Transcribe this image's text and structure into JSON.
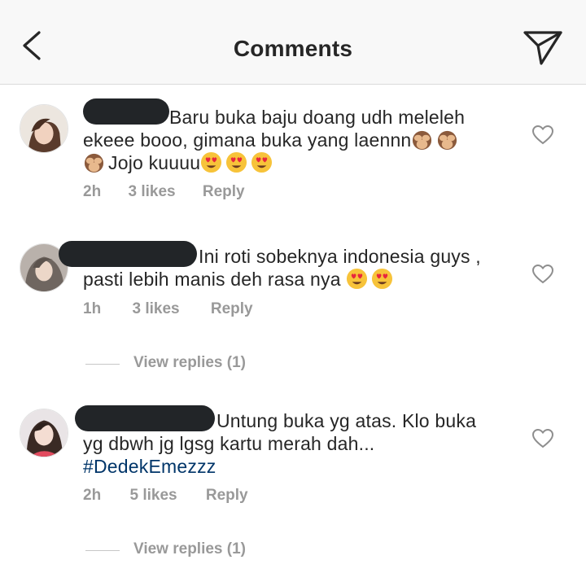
{
  "header": {
    "title": "Comments",
    "back_icon": "chevron-left-icon",
    "send_icon": "paper-plane-icon"
  },
  "comments": [
    {
      "lines": [
        "Baru buka baju doang udh meleleh",
        "ekeee booo, gimana buka yang laennn",
        "Jojo kuuuu"
      ],
      "time": "2h",
      "likes": "3 likes",
      "reply": "Reply"
    },
    {
      "lines": [
        "Ini roti sobeknya indonesia guys ,",
        "pasti lebih manis deh rasa nya"
      ],
      "time": "1h",
      "likes": "3 likes",
      "reply": "Reply",
      "view_replies": "View replies (1)"
    },
    {
      "lines": [
        "Untung buka yg atas. Klo buka",
        "yg dbwh jg lgsg kartu merah dah...",
        "#DedekEmezzz"
      ],
      "time": "2h",
      "likes": "5 likes",
      "reply": "Reply",
      "view_replies": "View replies (1)"
    }
  ],
  "colors": {
    "text": "#262626",
    "muted": "#999999",
    "hashtag": "#003569",
    "header_bg": "#f8f8f8"
  }
}
